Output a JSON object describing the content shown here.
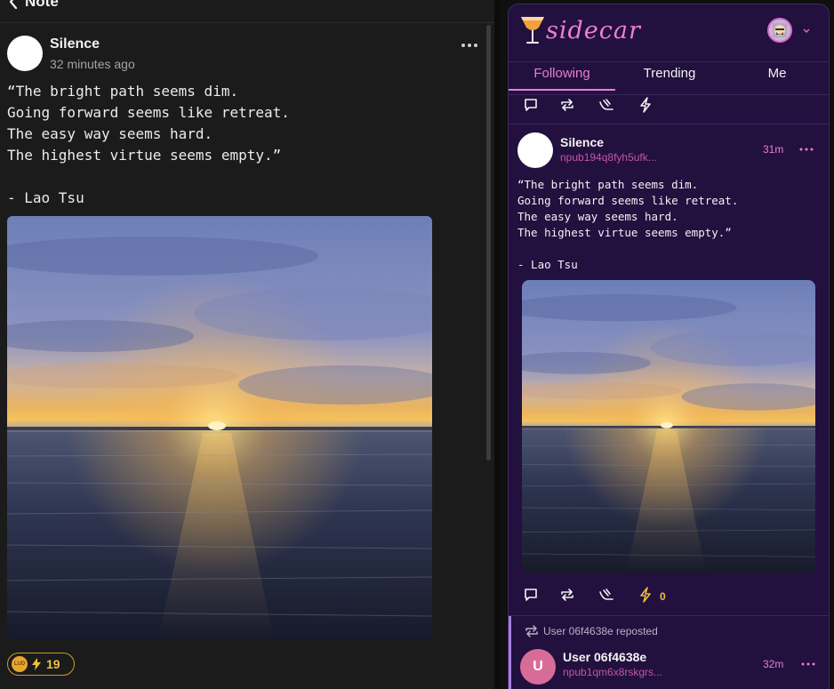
{
  "left": {
    "title": "Note",
    "author": "Silence",
    "time": "32 minutes ago",
    "text": "“The bright path seems dim.\nGoing forward seems like retreat.\nThe easy way seems hard.\nThe highest virtue seems empty.”\n\n- Lao Tsu",
    "zap_badge_label": "LUD",
    "zap_count": "19"
  },
  "right": {
    "logo_text": "sidecar",
    "tabs": [
      "Following",
      "Trending",
      "Me"
    ],
    "active_tab": "Following",
    "post": {
      "author": "Silence",
      "npub": "npub194q8fyh5ufk...",
      "time": "31m",
      "text": "“The bright path seems dim.\nGoing forward seems like retreat.\nThe easy way seems hard.\nThe highest virtue seems empty.”\n\n- Lao Tsu",
      "zaps": "0"
    },
    "repost": {
      "label": "User 06f4638e reposted",
      "avatar_letter": "U",
      "author": "User 06f4638e",
      "npub": "npub1qm6x8rskgrs...",
      "time": "32m"
    }
  },
  "colors": {
    "accent_pink": "#e77fcf",
    "zap_yellow": "#f0c040",
    "sidecar_bg": "#22103f"
  }
}
